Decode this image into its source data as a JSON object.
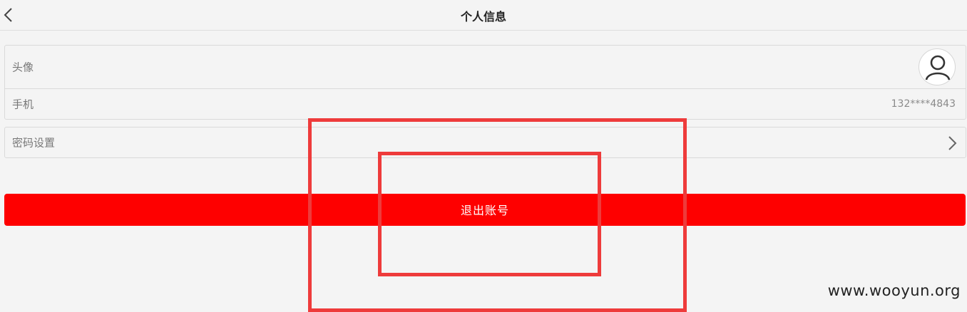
{
  "header": {
    "title": "个人信息",
    "back_icon": "chevron-left-icon"
  },
  "profile": {
    "avatar_label": "头像",
    "avatar_icon": "user-icon",
    "phone_label": "手机",
    "phone_value": "132****4843"
  },
  "settings": {
    "password_label": "密码设置",
    "chevron_icon": "chevron-right-icon"
  },
  "actions": {
    "logout_label": "退出账号"
  },
  "watermark": {
    "text": "www.wooyun.org"
  },
  "colors": {
    "background": "#f4f4f4",
    "logout_bg": "#fe0000",
    "annotation": "#ee3b3b"
  }
}
